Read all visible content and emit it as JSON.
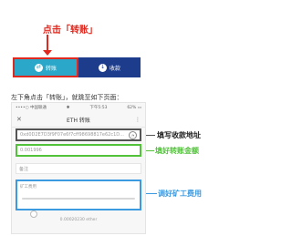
{
  "callout": {
    "click_prefix": "点击",
    "click_target": "「转账」"
  },
  "bottom_bar": {
    "transfer_label": "转账",
    "receive_label": "收款"
  },
  "instruction": "左下角点击「转账」，就跳至如下页面：",
  "status_bar": {
    "carrier": "••••○ 中国联通",
    "wifi": "✱",
    "time": "下午5:53",
    "battery": "62% ▭"
  },
  "nav": {
    "close": "✕",
    "title": "ETH 转账",
    "more": "⋮"
  },
  "form": {
    "address_value": "0xd0D2E7D3f9F07e6f7cff98698817e62c1D...",
    "amount_value": "0.001996",
    "note_placeholder": "备注",
    "fee_label": "矿工费用",
    "fee_value": "0.00020230 ether",
    "fee_level": 0.08
  },
  "annotations": {
    "address": "填写收款地址",
    "amount": "填好转账金额",
    "fee": "调好矿工费用"
  },
  "colors": {
    "red": "#e0281e",
    "teal": "#2aa7c9",
    "navy": "#1e3c8c",
    "green": "#52c23a",
    "blue": "#3b9ae0"
  },
  "icons": {
    "transfer": "transfer-circle-icon",
    "receive": "receive-circle-icon",
    "address_book": "contact-icon",
    "close": "close-icon",
    "more": "more-icon"
  }
}
